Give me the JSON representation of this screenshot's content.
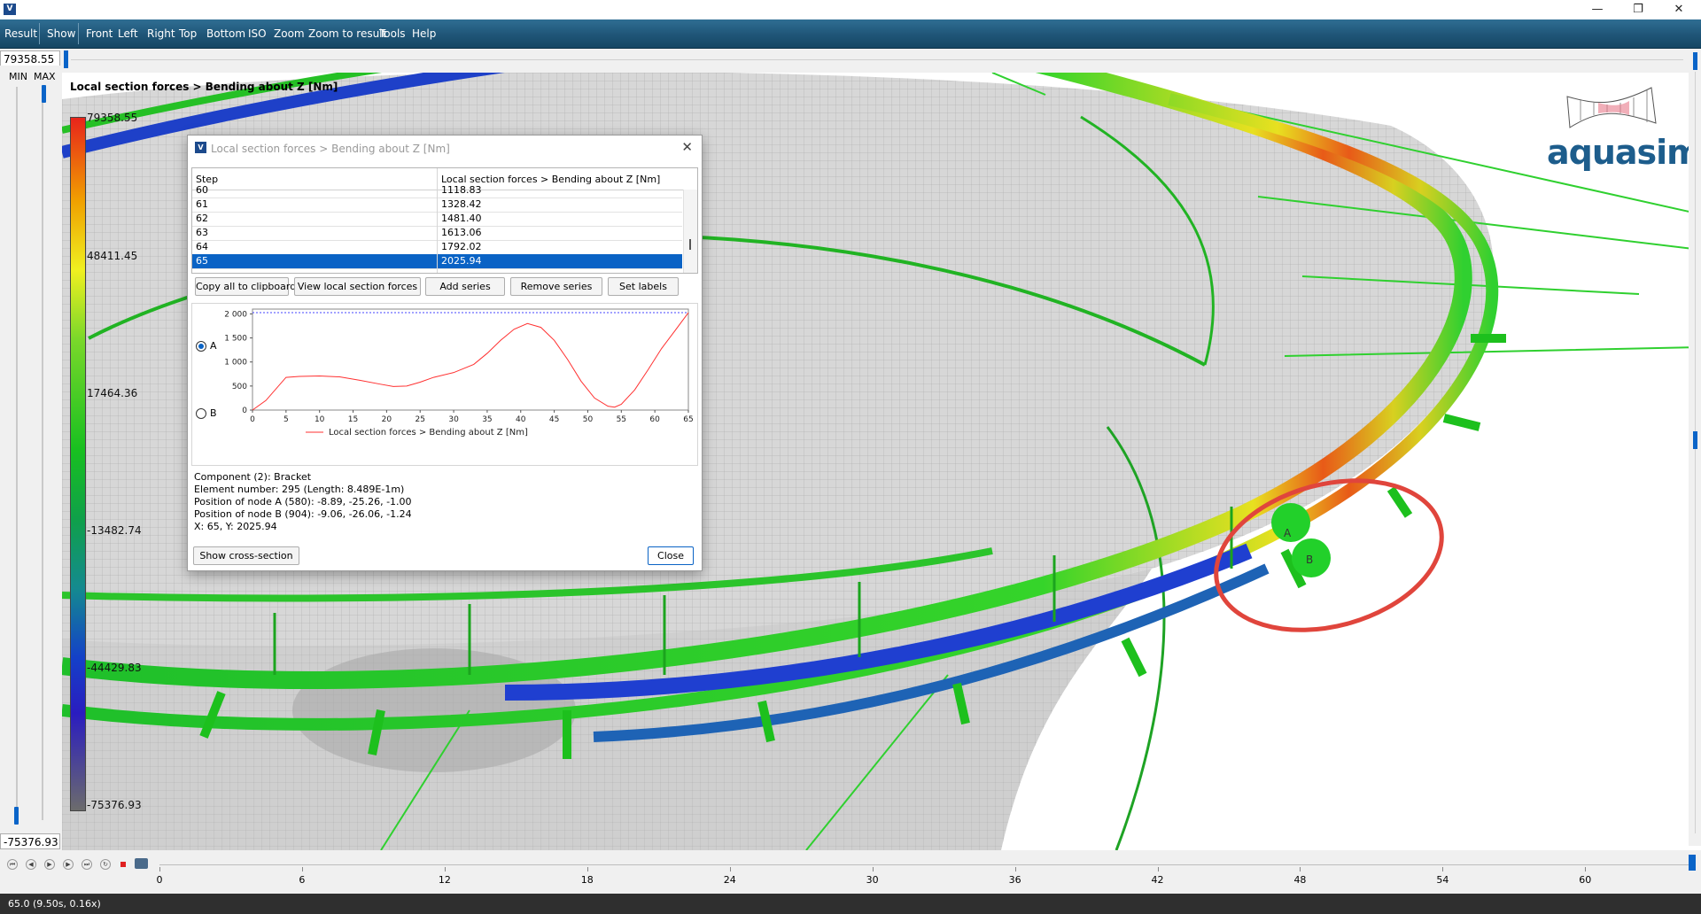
{
  "window": {
    "minimize": "—",
    "maximize": "❐",
    "close": "✕"
  },
  "menu": [
    "Result",
    "Show",
    "Front",
    "Left",
    "Right",
    "Top",
    "Bottom",
    "ISO",
    "Zoom",
    "Zoom to result",
    "Tools",
    "Help"
  ],
  "range": {
    "max_value": "79358.55",
    "min_value": "-75376.93",
    "min_label": "MIN",
    "max_label": "MAX"
  },
  "view": {
    "title": "Local section forces > Bending about Z [Nm]",
    "legend_labels": [
      "79358.55",
      "48411.45",
      "17464.36",
      "-13482.74",
      "-44429.83",
      "-75376.93"
    ],
    "node_labels": [
      "A",
      "B"
    ],
    "logo_text": "aquasim"
  },
  "dialog": {
    "title": "Local section forces > Bending about Z [Nm]",
    "columns": [
      "Step",
      "Local section forces > Bending about Z [Nm]"
    ],
    "rows": [
      {
        "step": "60",
        "value": "1118.83"
      },
      {
        "step": "61",
        "value": "1328.42"
      },
      {
        "step": "62",
        "value": "1481.40"
      },
      {
        "step": "63",
        "value": "1613.06"
      },
      {
        "step": "64",
        "value": "1792.02"
      },
      {
        "step": "65",
        "value": "2025.94",
        "selected": true
      }
    ],
    "buttons": {
      "copy": "Copy all to clipboard",
      "view": "View local section forces",
      "add": "Add series",
      "remove": "Remove series",
      "labels": "Set labels",
      "cross_section": "Show cross-section",
      "close": "Close"
    },
    "radio": {
      "a": "A",
      "b": "B",
      "selected": "A"
    },
    "info": [
      "Component (2): Bracket",
      "Element number: 295 (Length: 8.489E-1m)",
      "Position of node A (580): -8.89, -25.26, -1.00",
      "Position of node B (904): -9.06, -26.06, -1.24",
      "X: 65, Y: 2025.94"
    ]
  },
  "chart_data": {
    "type": "line",
    "title": "",
    "xlabel": "",
    "ylabel": "",
    "xlim": [
      0,
      65
    ],
    "ylim": [
      0,
      2100
    ],
    "x_ticks": [
      "0",
      "5",
      "10",
      "15",
      "20",
      "25",
      "30",
      "35",
      "40",
      "45",
      "50",
      "55",
      "60",
      "65"
    ],
    "y_ticks": [
      "0",
      "500",
      "1 000",
      "1 500",
      "2 000"
    ],
    "legend": "bottom",
    "series": [
      {
        "name": "Local section forces > Bending about Z [Nm]",
        "color": "#ff3030",
        "x": [
          0,
          2,
          5,
          7,
          10,
          13,
          16,
          19,
          21,
          23,
          25,
          27,
          30,
          33,
          35,
          37,
          39,
          41,
          43,
          45,
          47,
          49,
          51,
          53,
          54,
          55,
          57,
          59,
          61,
          63,
          65
        ],
        "y": [
          0,
          200,
          680,
          700,
          710,
          690,
          620,
          540,
          490,
          500,
          580,
          680,
          780,
          950,
          1180,
          1450,
          1680,
          1800,
          1720,
          1450,
          1050,
          600,
          250,
          80,
          60,
          120,
          420,
          840,
          1280,
          1650,
          2025.94
        ]
      },
      {
        "name": "",
        "color": "#4444ff",
        "dashed": true,
        "x": [
          0,
          65
        ],
        "y": [
          2025.94,
          2025.94
        ]
      }
    ]
  },
  "timeline": {
    "ticks": [
      "0",
      "6",
      "12",
      "18",
      "24",
      "30",
      "36",
      "42",
      "48",
      "54",
      "60"
    ],
    "max": 64.5,
    "position": 65
  },
  "status": "65.0 (9.50s, 0.16x)"
}
